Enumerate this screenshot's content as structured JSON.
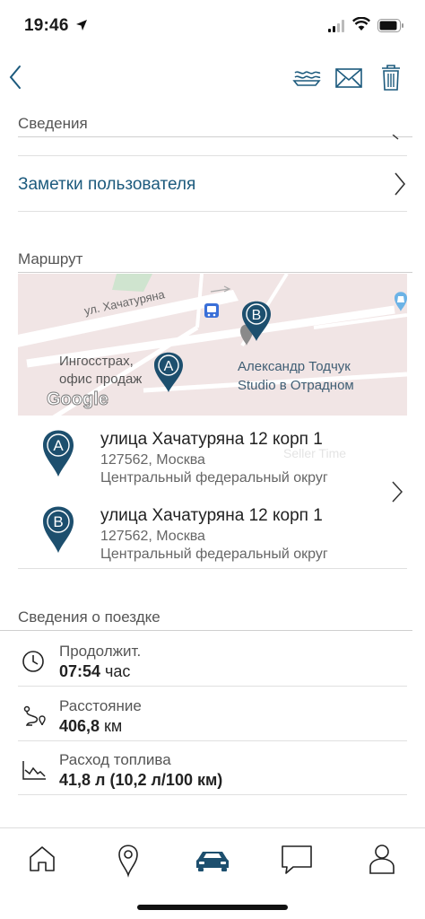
{
  "status_bar": {
    "time": "19:46"
  },
  "sections": {
    "details_title": "Сведения",
    "user_notes_label": "Заметки пользователя",
    "route_title": "Маршрут",
    "trip_title": "Сведения о поездке"
  },
  "map": {
    "street": "ул. Хачатуряна",
    "poi_left": [
      "Ингосстрах,",
      "офис продаж"
    ],
    "poi_right": [
      "Александр Тодчук",
      "Studio в Отрадном"
    ],
    "brand": "Google",
    "ghost_label": "Seller Time"
  },
  "route": {
    "stops": [
      {
        "marker": "A",
        "street": "улица Хачатуряна 12 корп 1",
        "city": "127562, Москва",
        "district": "Центральный федеральный округ"
      },
      {
        "marker": "B",
        "street": "улица Хачатуряна 12 корп 1",
        "city": "127562, Москва",
        "district": "Центральный федеральный округ"
      }
    ]
  },
  "trip": {
    "duration_label": "Продолжит.",
    "duration_value": "07:54",
    "duration_unit": " час",
    "distance_label": "Расстояние",
    "distance_value": "406,8",
    "distance_unit": " км",
    "fuel_label": "Расход топлива",
    "fuel_value": "41,8 л (10,2 л/100 км)"
  },
  "colors": {
    "accent": "#1c5a7d",
    "pin": "#1d4f6e",
    "map_bg": "#f0e4e4"
  },
  "icons": [
    "back-chevron",
    "share-icon",
    "mail-icon",
    "trash-icon",
    "clock-icon",
    "route-icon",
    "fuel-chart-icon",
    "home-icon",
    "location-pin-icon",
    "car-icon",
    "chat-icon",
    "user-icon"
  ]
}
